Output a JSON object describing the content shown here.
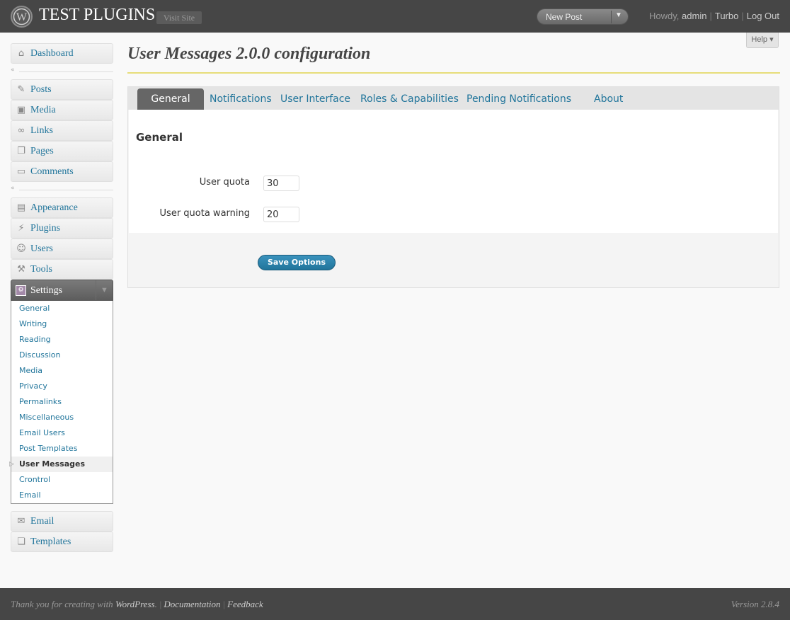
{
  "header": {
    "site_title": "TEST PLUGINS",
    "visit_site": "Visit Site",
    "new_post": "New Post",
    "howdy": "Howdy,",
    "user": "admin",
    "turbo": "Turbo",
    "logout": "Log Out",
    "help": "Help"
  },
  "menu": {
    "dashboard": "Dashboard",
    "posts": "Posts",
    "media": "Media",
    "links": "Links",
    "pages": "Pages",
    "comments": "Comments",
    "appearance": "Appearance",
    "plugins": "Plugins",
    "users": "Users",
    "tools": "Tools",
    "settings": "Settings",
    "email": "Email",
    "templates": "Templates",
    "settings_sub": [
      "General",
      "Writing",
      "Reading",
      "Discussion",
      "Media",
      "Privacy",
      "Permalinks",
      "Miscellaneous",
      "Email Users",
      "Post Templates",
      "User Messages",
      "Crontrol",
      "Email"
    ]
  },
  "main": {
    "title": "User Messages 2.0.0 configuration",
    "tabs": [
      "General",
      "Notifications",
      "User Interface",
      "Roles & Capabilities",
      "Pending Notifications",
      "About"
    ],
    "section_title": "General",
    "fields": [
      {
        "label": "User quota",
        "value": "30"
      },
      {
        "label": "User quota warning",
        "value": "20"
      }
    ],
    "save_label": "Save Options"
  },
  "footer": {
    "thanks": "Thank you for creating with",
    "wordpress": "WordPress",
    "documentation": "Documentation",
    "feedback": "Feedback",
    "version": "Version 2.8.4"
  },
  "colors": {
    "header_bg": "#464646",
    "link": "#21759b",
    "accent_rule": "#e7dd7a",
    "button": "#21759b"
  }
}
